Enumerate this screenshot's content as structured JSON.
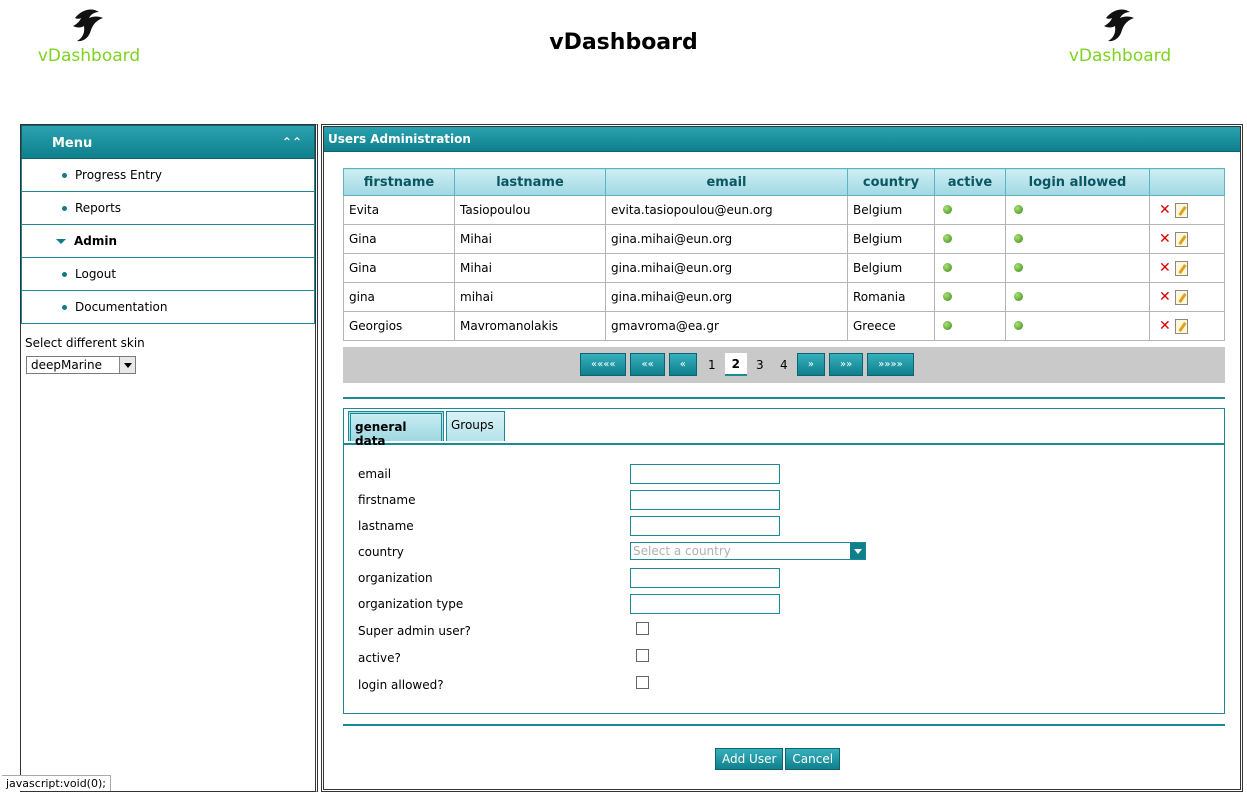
{
  "header": {
    "title": "vDashboard",
    "logo_text_left": "vDashboard",
    "logo_text_right": "vDashboard"
  },
  "sidebar": {
    "menu_title": "Menu",
    "items": [
      {
        "label": "Progress Entry"
      },
      {
        "label": "Reports"
      },
      {
        "label": "Admin"
      },
      {
        "label": "Logout"
      },
      {
        "label": "Documentation"
      }
    ],
    "skin_label": "Select different skin",
    "skin_value": "deepMarine"
  },
  "status_bar": "javascript:void(0);",
  "main": {
    "panel_title": "Users Administration",
    "table": {
      "headers": [
        "firstname",
        "lastname",
        "email",
        "country",
        "active",
        "login allowed",
        ""
      ],
      "rows": [
        {
          "firstname": "Evita",
          "lastname": "Tasiopoulou",
          "email": "evita.tasiopoulou@eun.org",
          "country": "Belgium"
        },
        {
          "firstname": "Gina",
          "lastname": "Mihai",
          "email": "gina.mihai@eun.org",
          "country": "Belgium"
        },
        {
          "firstname": "Gina",
          "lastname": "Mihai",
          "email": "gina.mihai@eun.org",
          "country": "Belgium"
        },
        {
          "firstname": "gina",
          "lastname": "mihai",
          "email": "gina.mihai@eun.org",
          "country": "Romania"
        },
        {
          "firstname": "Georgios",
          "lastname": "Mavromanolakis",
          "email": "gmavroma@ea.gr",
          "country": "Greece"
        }
      ]
    },
    "pager": {
      "first": "««««",
      "fast_prev": "««",
      "prev": "«",
      "pages": [
        "1",
        "2",
        "3",
        "4"
      ],
      "current": "2",
      "next": "»",
      "fast_next": "»»",
      "last": "»»»»"
    },
    "tabs": {
      "general": "general data",
      "groups": "Groups"
    },
    "form": {
      "email_label": "email",
      "firstname_label": "firstname",
      "lastname_label": "lastname",
      "country_label": "country",
      "country_placeholder": "Select a country",
      "organization_label": "organization",
      "organization_type_label": "organization type",
      "super_admin_label": "Super admin user?",
      "active_label": "active?",
      "login_allowed_label": "login allowed?"
    },
    "buttons": {
      "add_user": "Add User",
      "cancel": "Cancel"
    }
  },
  "colors": {
    "accent": "#1a8a96",
    "logo_green": "#7ed321",
    "status_active": "#3a8a12",
    "delete_red": "#dd0000"
  }
}
